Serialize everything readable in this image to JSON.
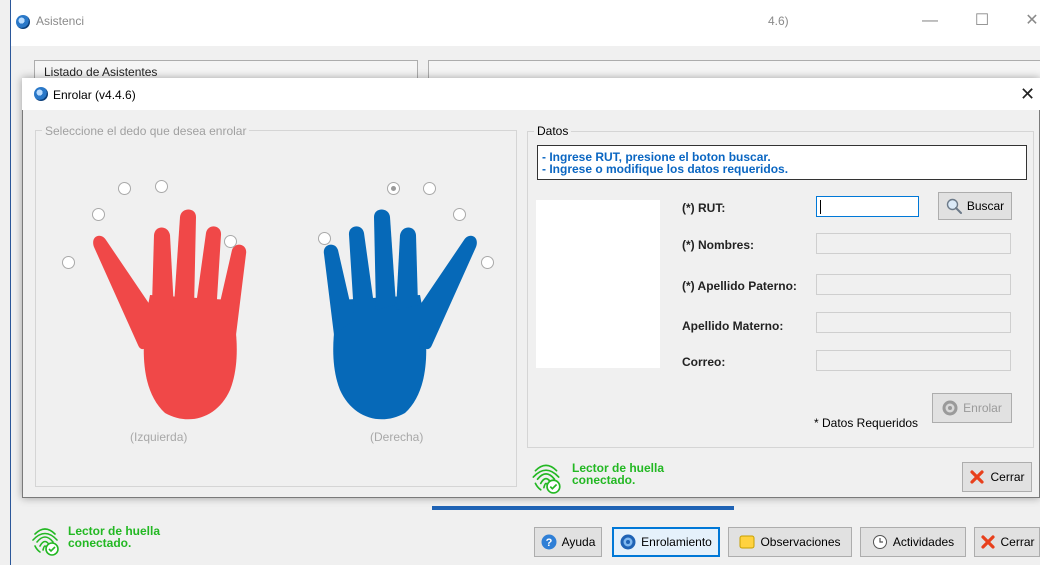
{
  "main_window": {
    "title": "Asistenci",
    "version_fragment": "4.6)",
    "list_header": "Listado de Asistentes",
    "fingerprint_status_line1": "Lector de huella",
    "fingerprint_status_line2": "conectado.",
    "buttons": {
      "help": "Ayuda",
      "enrollment": "Enrolamiento",
      "observations": "Observaciones",
      "activities": "Actividades",
      "close": "Cerrar"
    }
  },
  "dialog": {
    "title": "Enrolar (v4.4.6)",
    "finger_group_label": "Seleccione el dedo que desea enrolar",
    "left_hand_caption": "(Izquierda)",
    "right_hand_caption": "(Derecha)",
    "datos": {
      "legend": "Datos",
      "instructions": [
        "- Ingrese RUT, presione el boton buscar.",
        "- Ingrese o modifique los datos requeridos."
      ],
      "fields": {
        "rut_label": "(*) RUT:",
        "rut_value": "",
        "nombres_label": "(*) Nombres:",
        "apellido_paterno_label": "(*) Apellido Paterno:",
        "apellido_materno_label": "Apellido Materno:",
        "correo_label": "Correo:"
      },
      "search_button": "Buscar",
      "required_note": "* Datos Requeridos",
      "enroll_button": "Enrolar"
    },
    "fingerprint_status_line1": "Lector de huella",
    "fingerprint_status_line2": "conectado.",
    "close_button": "Cerrar"
  },
  "colors": {
    "left_hand": "#f04848",
    "right_hand": "#0669b8",
    "status_green": "#23b823",
    "instruction_blue": "#0a66c2"
  },
  "icons": [
    "app-icon",
    "minimize-icon",
    "maximize-icon",
    "close-icon",
    "fingerprint-icon",
    "help-icon",
    "enrollment-icon",
    "note-icon",
    "clock-icon",
    "cancel-x-icon",
    "search-icon",
    "enroll-icon"
  ]
}
